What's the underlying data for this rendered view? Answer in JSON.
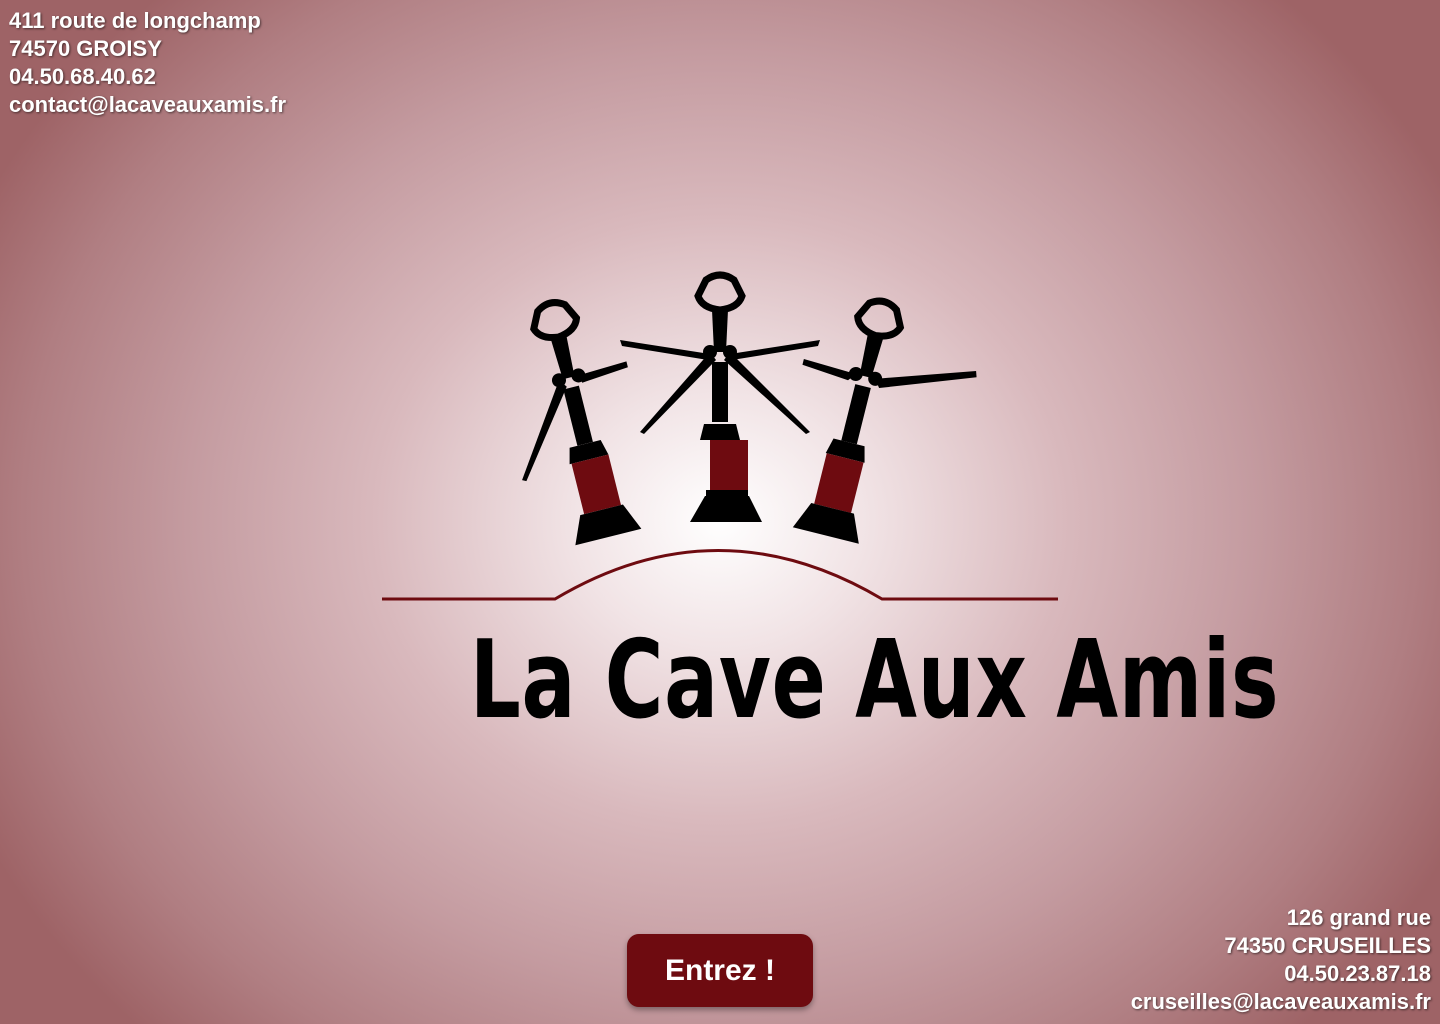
{
  "site": {
    "name": "La Cave Aux Amis",
    "brand_color": "#6e0b10"
  },
  "store_groisy": {
    "street": "411 route de longchamp",
    "city": "74570 GROISY",
    "phone": "04.50.68.40.62",
    "email": "contact@lacaveauxamis.fr"
  },
  "store_cruseilles": {
    "street": "126 grand rue",
    "city": "74350 CRUSEILLES",
    "phone": "04.50.23.87.18",
    "email": "cruseilles@lacaveauxamis.fr"
  },
  "logo": {
    "icon": "corkscrew-trio-icon"
  },
  "enter_button": {
    "label": "Entrez !"
  }
}
